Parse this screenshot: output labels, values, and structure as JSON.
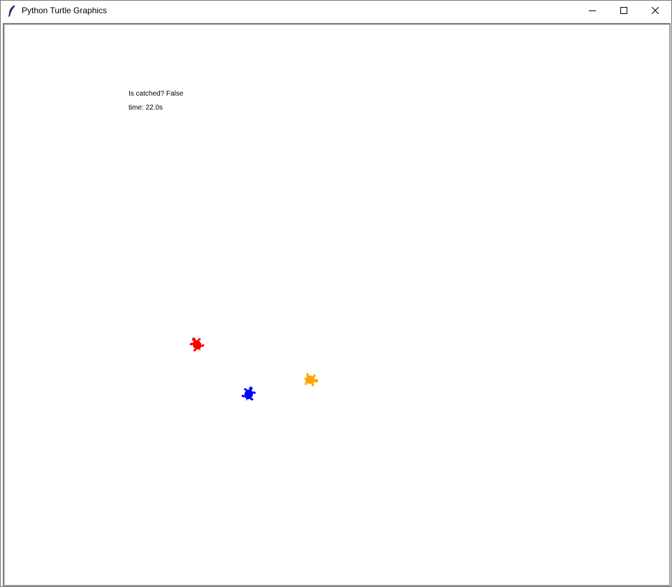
{
  "window": {
    "title": "Python Turtle Graphics",
    "app_icon": "feather-icon",
    "controls": {
      "minimize_icon": "minimize-icon",
      "maximize_icon": "maximize-icon",
      "close_icon": "close-icon"
    }
  },
  "hud": {
    "caught_label": "Is catched? False",
    "time_label": "time: 22.0s"
  },
  "turtles": [
    {
      "name": "red-turtle",
      "color": "#ff0000"
    },
    {
      "name": "blue-turtle",
      "color": "#0000ff"
    },
    {
      "name": "orange-turtle",
      "color": "#ffa500"
    }
  ]
}
